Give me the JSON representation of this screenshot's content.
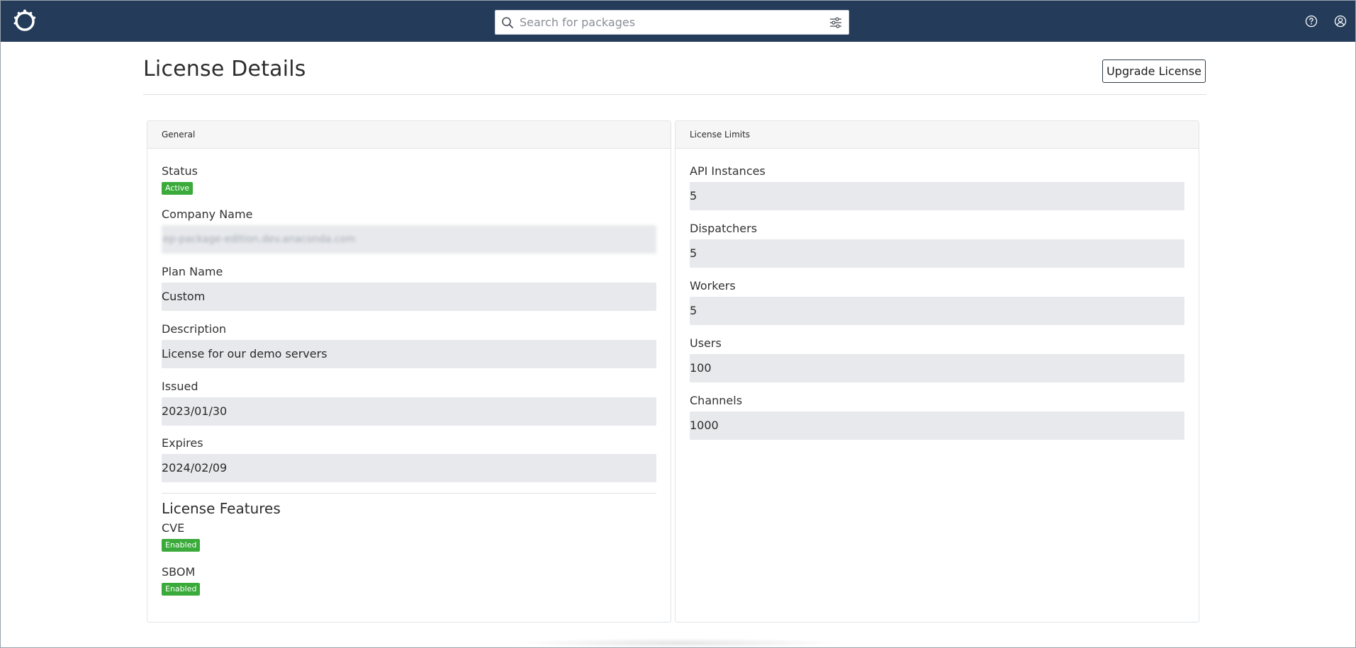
{
  "search": {
    "placeholder": "Search for packages"
  },
  "page": {
    "title": "License Details",
    "upgrade_label": "Upgrade License"
  },
  "general": {
    "header": "General",
    "status_label": "Status",
    "status_value": "Active",
    "company_label": "Company Name",
    "company_value": "ep-package-edition.dev.anaconda.com",
    "plan_label": "Plan Name",
    "plan_value": "Custom",
    "description_label": "Description",
    "description_value": "License for our demo servers",
    "issued_label": "Issued",
    "issued_value": "2023/01/30",
    "expires_label": "Expires",
    "expires_value": "2024/02/09",
    "features_title": "License Features",
    "features": [
      {
        "label": "CVE",
        "state": "Enabled"
      },
      {
        "label": "SBOM",
        "state": "Enabled"
      }
    ]
  },
  "limits": {
    "header": "License Limits",
    "items": [
      {
        "label": "API Instances",
        "value": "5"
      },
      {
        "label": "Dispatchers",
        "value": "5"
      },
      {
        "label": "Workers",
        "value": "5"
      },
      {
        "label": "Users",
        "value": "100"
      },
      {
        "label": "Channels",
        "value": "1000"
      }
    ]
  },
  "colors": {
    "topbar": "#243c5a",
    "badge_green": "#3aab3a",
    "field_bg": "#e7e9ec"
  },
  "icons": [
    "anaconda-logo-icon",
    "search-icon",
    "filter-sliders-icon",
    "help-icon",
    "user-account-icon"
  ]
}
